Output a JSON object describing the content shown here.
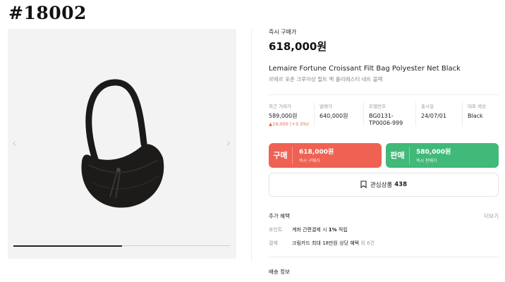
{
  "post_id": "#18002",
  "gallery": {
    "prev_arrow": "‹",
    "next_arrow": "›",
    "progress": 0.5
  },
  "product": {
    "price_label": "즉시 구매가",
    "price": "618,000원",
    "title_en": "Lemaire Fortune Croissant Filt Bag Polyester Net Black",
    "title_ko": "르메르 포춘 크루아상 필트 백 폴리에스터 네트 블랙"
  },
  "specs": {
    "recent": {
      "label": "최근 거래가",
      "value": "589,000원",
      "change": "▲19,000 (+3.3%)"
    },
    "release_price": {
      "label": "발매가",
      "value": "640,000원"
    },
    "model": {
      "label": "모델번호",
      "value_line1": "BG0131-",
      "value_line2": "TP0006-999"
    },
    "release_date": {
      "label": "출시일",
      "value": "24/07/01"
    },
    "color": {
      "label": "대표 색상",
      "value": "Black"
    }
  },
  "buy": {
    "tag": "구매",
    "price": "618,000원",
    "sub": "즉시 구매가"
  },
  "sell": {
    "tag": "판매",
    "price": "580,000원",
    "sub": "즉시 판매가"
  },
  "wishlist": {
    "label": "관심상품",
    "count": "438"
  },
  "benefits": {
    "title": "추가 혜택",
    "more": "더보기",
    "point": {
      "key": "포인트",
      "text_before": "계좌 간편결제 시 ",
      "highlight": "1%",
      "text_after": " 적립"
    },
    "payment": {
      "key": "결제",
      "text": "크림카드 최대 18만원 상당 혜택",
      "suffix": " 외 6건"
    }
  },
  "shipping": {
    "title": "배송 정보"
  },
  "colors": {
    "buy": "#ef6253",
    "sell": "#41b979",
    "accent_text": "#ef6253"
  }
}
